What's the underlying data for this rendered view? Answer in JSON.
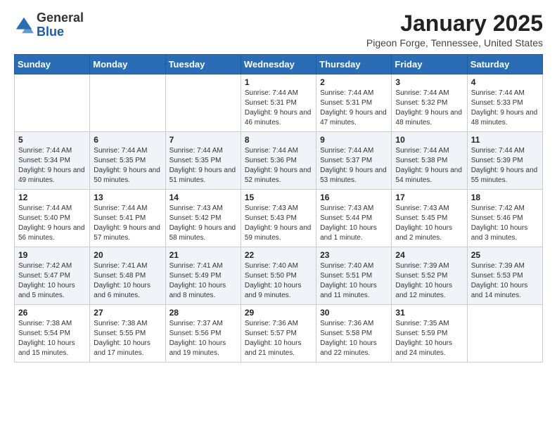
{
  "header": {
    "logo_general": "General",
    "logo_blue": "Blue",
    "month": "January 2025",
    "location": "Pigeon Forge, Tennessee, United States"
  },
  "weekdays": [
    "Sunday",
    "Monday",
    "Tuesday",
    "Wednesday",
    "Thursday",
    "Friday",
    "Saturday"
  ],
  "weeks": [
    [
      {
        "day": "",
        "info": ""
      },
      {
        "day": "",
        "info": ""
      },
      {
        "day": "",
        "info": ""
      },
      {
        "day": "1",
        "info": "Sunrise: 7:44 AM\nSunset: 5:31 PM\nDaylight: 9 hours and 46 minutes."
      },
      {
        "day": "2",
        "info": "Sunrise: 7:44 AM\nSunset: 5:31 PM\nDaylight: 9 hours and 47 minutes."
      },
      {
        "day": "3",
        "info": "Sunrise: 7:44 AM\nSunset: 5:32 PM\nDaylight: 9 hours and 48 minutes."
      },
      {
        "day": "4",
        "info": "Sunrise: 7:44 AM\nSunset: 5:33 PM\nDaylight: 9 hours and 48 minutes."
      }
    ],
    [
      {
        "day": "5",
        "info": "Sunrise: 7:44 AM\nSunset: 5:34 PM\nDaylight: 9 hours and 49 minutes."
      },
      {
        "day": "6",
        "info": "Sunrise: 7:44 AM\nSunset: 5:35 PM\nDaylight: 9 hours and 50 minutes."
      },
      {
        "day": "7",
        "info": "Sunrise: 7:44 AM\nSunset: 5:35 PM\nDaylight: 9 hours and 51 minutes."
      },
      {
        "day": "8",
        "info": "Sunrise: 7:44 AM\nSunset: 5:36 PM\nDaylight: 9 hours and 52 minutes."
      },
      {
        "day": "9",
        "info": "Sunrise: 7:44 AM\nSunset: 5:37 PM\nDaylight: 9 hours and 53 minutes."
      },
      {
        "day": "10",
        "info": "Sunrise: 7:44 AM\nSunset: 5:38 PM\nDaylight: 9 hours and 54 minutes."
      },
      {
        "day": "11",
        "info": "Sunrise: 7:44 AM\nSunset: 5:39 PM\nDaylight: 9 hours and 55 minutes."
      }
    ],
    [
      {
        "day": "12",
        "info": "Sunrise: 7:44 AM\nSunset: 5:40 PM\nDaylight: 9 hours and 56 minutes."
      },
      {
        "day": "13",
        "info": "Sunrise: 7:44 AM\nSunset: 5:41 PM\nDaylight: 9 hours and 57 minutes."
      },
      {
        "day": "14",
        "info": "Sunrise: 7:43 AM\nSunset: 5:42 PM\nDaylight: 9 hours and 58 minutes."
      },
      {
        "day": "15",
        "info": "Sunrise: 7:43 AM\nSunset: 5:43 PM\nDaylight: 9 hours and 59 minutes."
      },
      {
        "day": "16",
        "info": "Sunrise: 7:43 AM\nSunset: 5:44 PM\nDaylight: 10 hours and 1 minute."
      },
      {
        "day": "17",
        "info": "Sunrise: 7:43 AM\nSunset: 5:45 PM\nDaylight: 10 hours and 2 minutes."
      },
      {
        "day": "18",
        "info": "Sunrise: 7:42 AM\nSunset: 5:46 PM\nDaylight: 10 hours and 3 minutes."
      }
    ],
    [
      {
        "day": "19",
        "info": "Sunrise: 7:42 AM\nSunset: 5:47 PM\nDaylight: 10 hours and 5 minutes."
      },
      {
        "day": "20",
        "info": "Sunrise: 7:41 AM\nSunset: 5:48 PM\nDaylight: 10 hours and 6 minutes."
      },
      {
        "day": "21",
        "info": "Sunrise: 7:41 AM\nSunset: 5:49 PM\nDaylight: 10 hours and 8 minutes."
      },
      {
        "day": "22",
        "info": "Sunrise: 7:40 AM\nSunset: 5:50 PM\nDaylight: 10 hours and 9 minutes."
      },
      {
        "day": "23",
        "info": "Sunrise: 7:40 AM\nSunset: 5:51 PM\nDaylight: 10 hours and 11 minutes."
      },
      {
        "day": "24",
        "info": "Sunrise: 7:39 AM\nSunset: 5:52 PM\nDaylight: 10 hours and 12 minutes."
      },
      {
        "day": "25",
        "info": "Sunrise: 7:39 AM\nSunset: 5:53 PM\nDaylight: 10 hours and 14 minutes."
      }
    ],
    [
      {
        "day": "26",
        "info": "Sunrise: 7:38 AM\nSunset: 5:54 PM\nDaylight: 10 hours and 15 minutes."
      },
      {
        "day": "27",
        "info": "Sunrise: 7:38 AM\nSunset: 5:55 PM\nDaylight: 10 hours and 17 minutes."
      },
      {
        "day": "28",
        "info": "Sunrise: 7:37 AM\nSunset: 5:56 PM\nDaylight: 10 hours and 19 minutes."
      },
      {
        "day": "29",
        "info": "Sunrise: 7:36 AM\nSunset: 5:57 PM\nDaylight: 10 hours and 21 minutes."
      },
      {
        "day": "30",
        "info": "Sunrise: 7:36 AM\nSunset: 5:58 PM\nDaylight: 10 hours and 22 minutes."
      },
      {
        "day": "31",
        "info": "Sunrise: 7:35 AM\nSunset: 5:59 PM\nDaylight: 10 hours and 24 minutes."
      },
      {
        "day": "",
        "info": ""
      }
    ]
  ]
}
